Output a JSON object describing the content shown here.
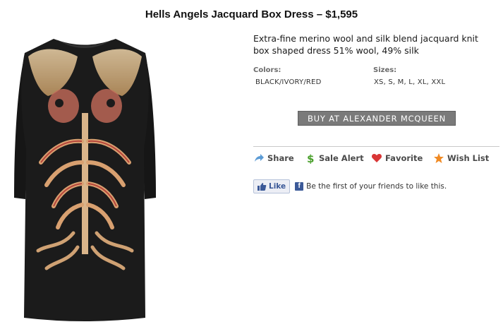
{
  "product": {
    "title": "Hells Angels Jacquard Box Dress – $1,595",
    "description": "Extra-fine merino wool and silk blend jacquard knit box shaped dress 51% wool, 49% silk",
    "colors_label": "Colors:",
    "colors_value": "BLACK/IVORY/RED",
    "sizes_label": "Sizes:",
    "sizes_value": "XS, S, M, L, XL, XXL",
    "buy_label": "BUY AT ALEXANDER MCQUEEN",
    "image_icon": "dress-photo"
  },
  "actions": [
    {
      "label": "Share",
      "icon": "share-arrow-icon",
      "color": "#5b9bd5"
    },
    {
      "label": "Sale Alert",
      "icon": "dollar-icon",
      "color": "#4aa02c"
    },
    {
      "label": "Favorite",
      "icon": "heart-icon",
      "color": "#d93636"
    },
    {
      "label": "Wish List",
      "icon": "star-icon",
      "color": "#f08a24"
    }
  ],
  "facebook": {
    "like_label": "Like",
    "like_icon": "thumbs-up-icon",
    "text": "Be the first of your friends to like this.",
    "brand_color": "#3b5998"
  }
}
